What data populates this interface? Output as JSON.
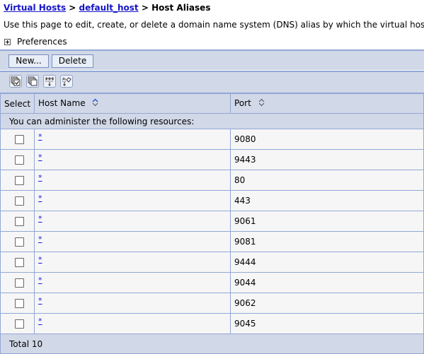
{
  "breadcrumb": {
    "items": [
      {
        "label": "Virtual Hosts",
        "link": true
      },
      {
        "label": "default_host",
        "link": true
      },
      {
        "label": "Host Aliases",
        "link": false
      }
    ],
    "separator": ">"
  },
  "description": "Use this page to edit, create, or delete a domain name system (DNS) alias by which the virtual host is known.",
  "preferences": {
    "label": "Preferences",
    "icon": "expand-plus-icon"
  },
  "toolbar": {
    "new_label": "New...",
    "delete_label": "Delete",
    "icons": [
      "select-all-icon",
      "deselect-all-icon",
      "show-filter-icon",
      "clear-filter-icon"
    ]
  },
  "table": {
    "columns": [
      {
        "label": "Select"
      },
      {
        "label": "Host Name",
        "sort": "ascending"
      },
      {
        "label": "Port",
        "sort": "none"
      }
    ],
    "notice": "You can administer the following resources:",
    "rows": [
      {
        "host": "*",
        "port": "9080",
        "checked": false
      },
      {
        "host": "*",
        "port": "9443",
        "checked": false
      },
      {
        "host": "*",
        "port": "80",
        "checked": false
      },
      {
        "host": "*",
        "port": "443",
        "checked": false
      },
      {
        "host": "*",
        "port": "9061",
        "checked": false
      },
      {
        "host": "*",
        "port": "9081",
        "checked": false
      },
      {
        "host": "*",
        "port": "9444",
        "checked": false
      },
      {
        "host": "*",
        "port": "9044",
        "checked": false
      },
      {
        "host": "*",
        "port": "9062",
        "checked": false
      },
      {
        "host": "*",
        "port": "9045",
        "checked": false
      }
    ],
    "total": "Total 10"
  },
  "colors": {
    "link": "#1515c8",
    "bar_bg": "#d1d8e7",
    "border": "#93a8d6",
    "row_bg": "#f6f6f6",
    "sort_active": "#1a4fd0"
  }
}
